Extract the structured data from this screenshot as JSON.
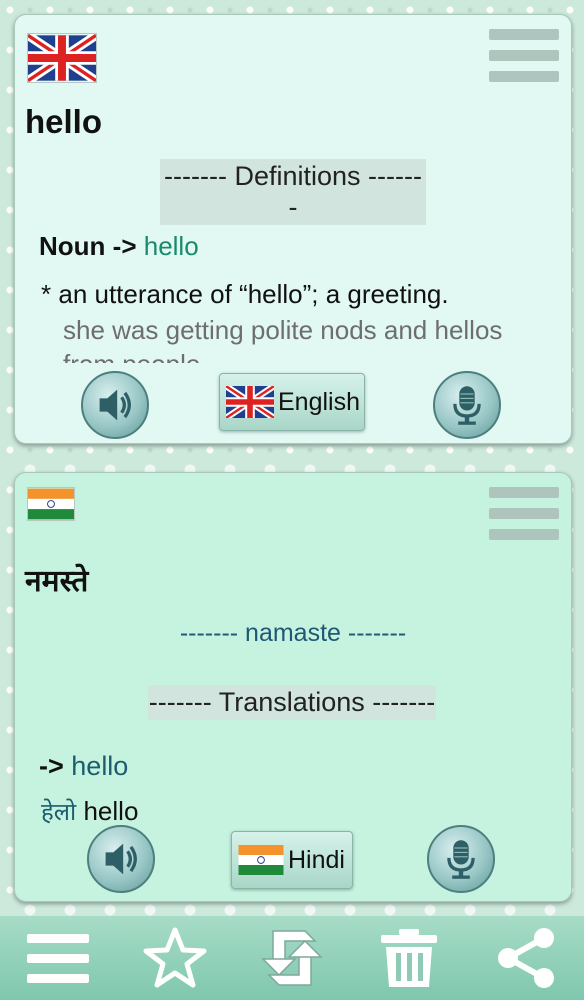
{
  "source": {
    "word": "hello",
    "section_label": "------- Definitions -------",
    "definition": {
      "pos": "Noun",
      "arrow": "->",
      "headword": "hello",
      "bullet": "*",
      "text": "an utterance of “hello”; a greeting.",
      "example": "she was getting polite nods and hellos from people"
    },
    "language_button": "English",
    "flag": "uk-flag-icon"
  },
  "target": {
    "word": "नमस्ते",
    "transliteration": "------- namaste -------",
    "section_label": "------- Translations -------",
    "translation": {
      "arrow": "->",
      "headword": "hello",
      "hindi": "हेलो",
      "english": "hello"
    },
    "language_button": "Hindi",
    "flag": "india-flag-icon"
  },
  "colors": {
    "accent": "#1a8a6a",
    "translit": "#1f5872",
    "top_card": "#e1f9f2",
    "bottom_card": "#c6f3e0",
    "toolbar": "#8fd0b8"
  },
  "toolbar": {
    "items": [
      "menu-icon",
      "star-icon",
      "swap-icon",
      "trash-icon",
      "share-icon"
    ]
  }
}
